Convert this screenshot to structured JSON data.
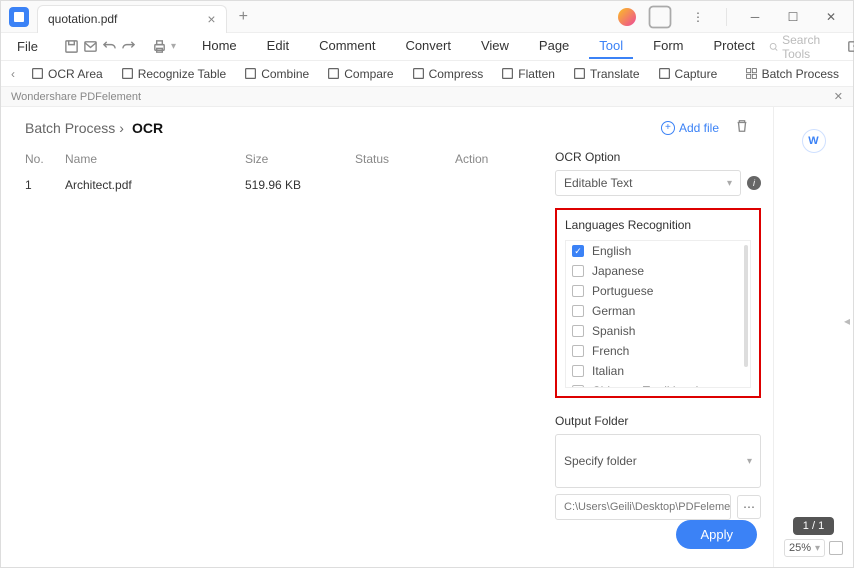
{
  "titlebar": {
    "tab_title": "quotation.pdf"
  },
  "menubar": {
    "file": "File",
    "items": [
      "Home",
      "Edit",
      "Comment",
      "Convert",
      "View",
      "Page",
      "Tool",
      "Form",
      "Protect"
    ],
    "active": "Tool",
    "search_placeholder": "Search Tools"
  },
  "ribbon": {
    "items": [
      "OCR Area",
      "Recognize Table",
      "Combine",
      "Compare",
      "Compress",
      "Flatten",
      "Translate",
      "Capture"
    ],
    "batch": "Batch Process"
  },
  "panel": {
    "label": "Wondershare PDFelement",
    "breadcrumb_root": "Batch Process",
    "breadcrumb_sep": "›",
    "breadcrumb_current": "OCR",
    "add_file": "Add file",
    "columns": {
      "no": "No.",
      "name": "Name",
      "size": "Size",
      "status": "Status",
      "action": "Action"
    },
    "rows": [
      {
        "no": "1",
        "name": "Architect.pdf",
        "size": "519.96 KB",
        "status": "",
        "action": ""
      }
    ]
  },
  "options": {
    "ocr_option_label": "OCR Option",
    "ocr_option_value": "Editable Text",
    "languages_label": "Languages Recognition",
    "languages": [
      {
        "label": "English",
        "checked": true
      },
      {
        "label": "Japanese",
        "checked": false
      },
      {
        "label": "Portuguese",
        "checked": false
      },
      {
        "label": "German",
        "checked": false
      },
      {
        "label": "Spanish",
        "checked": false
      },
      {
        "label": "French",
        "checked": false
      },
      {
        "label": "Italian",
        "checked": false
      },
      {
        "label": "Chinese_Traditional",
        "checked": false
      }
    ],
    "output_label": "Output Folder",
    "specify_folder": "Specify folder",
    "output_path": "C:\\Users\\Geili\\Desktop\\PDFelement\\OC",
    "apply": "Apply"
  },
  "sidebar": {
    "page_indicator": "1 / 1",
    "zoom": "25%"
  }
}
